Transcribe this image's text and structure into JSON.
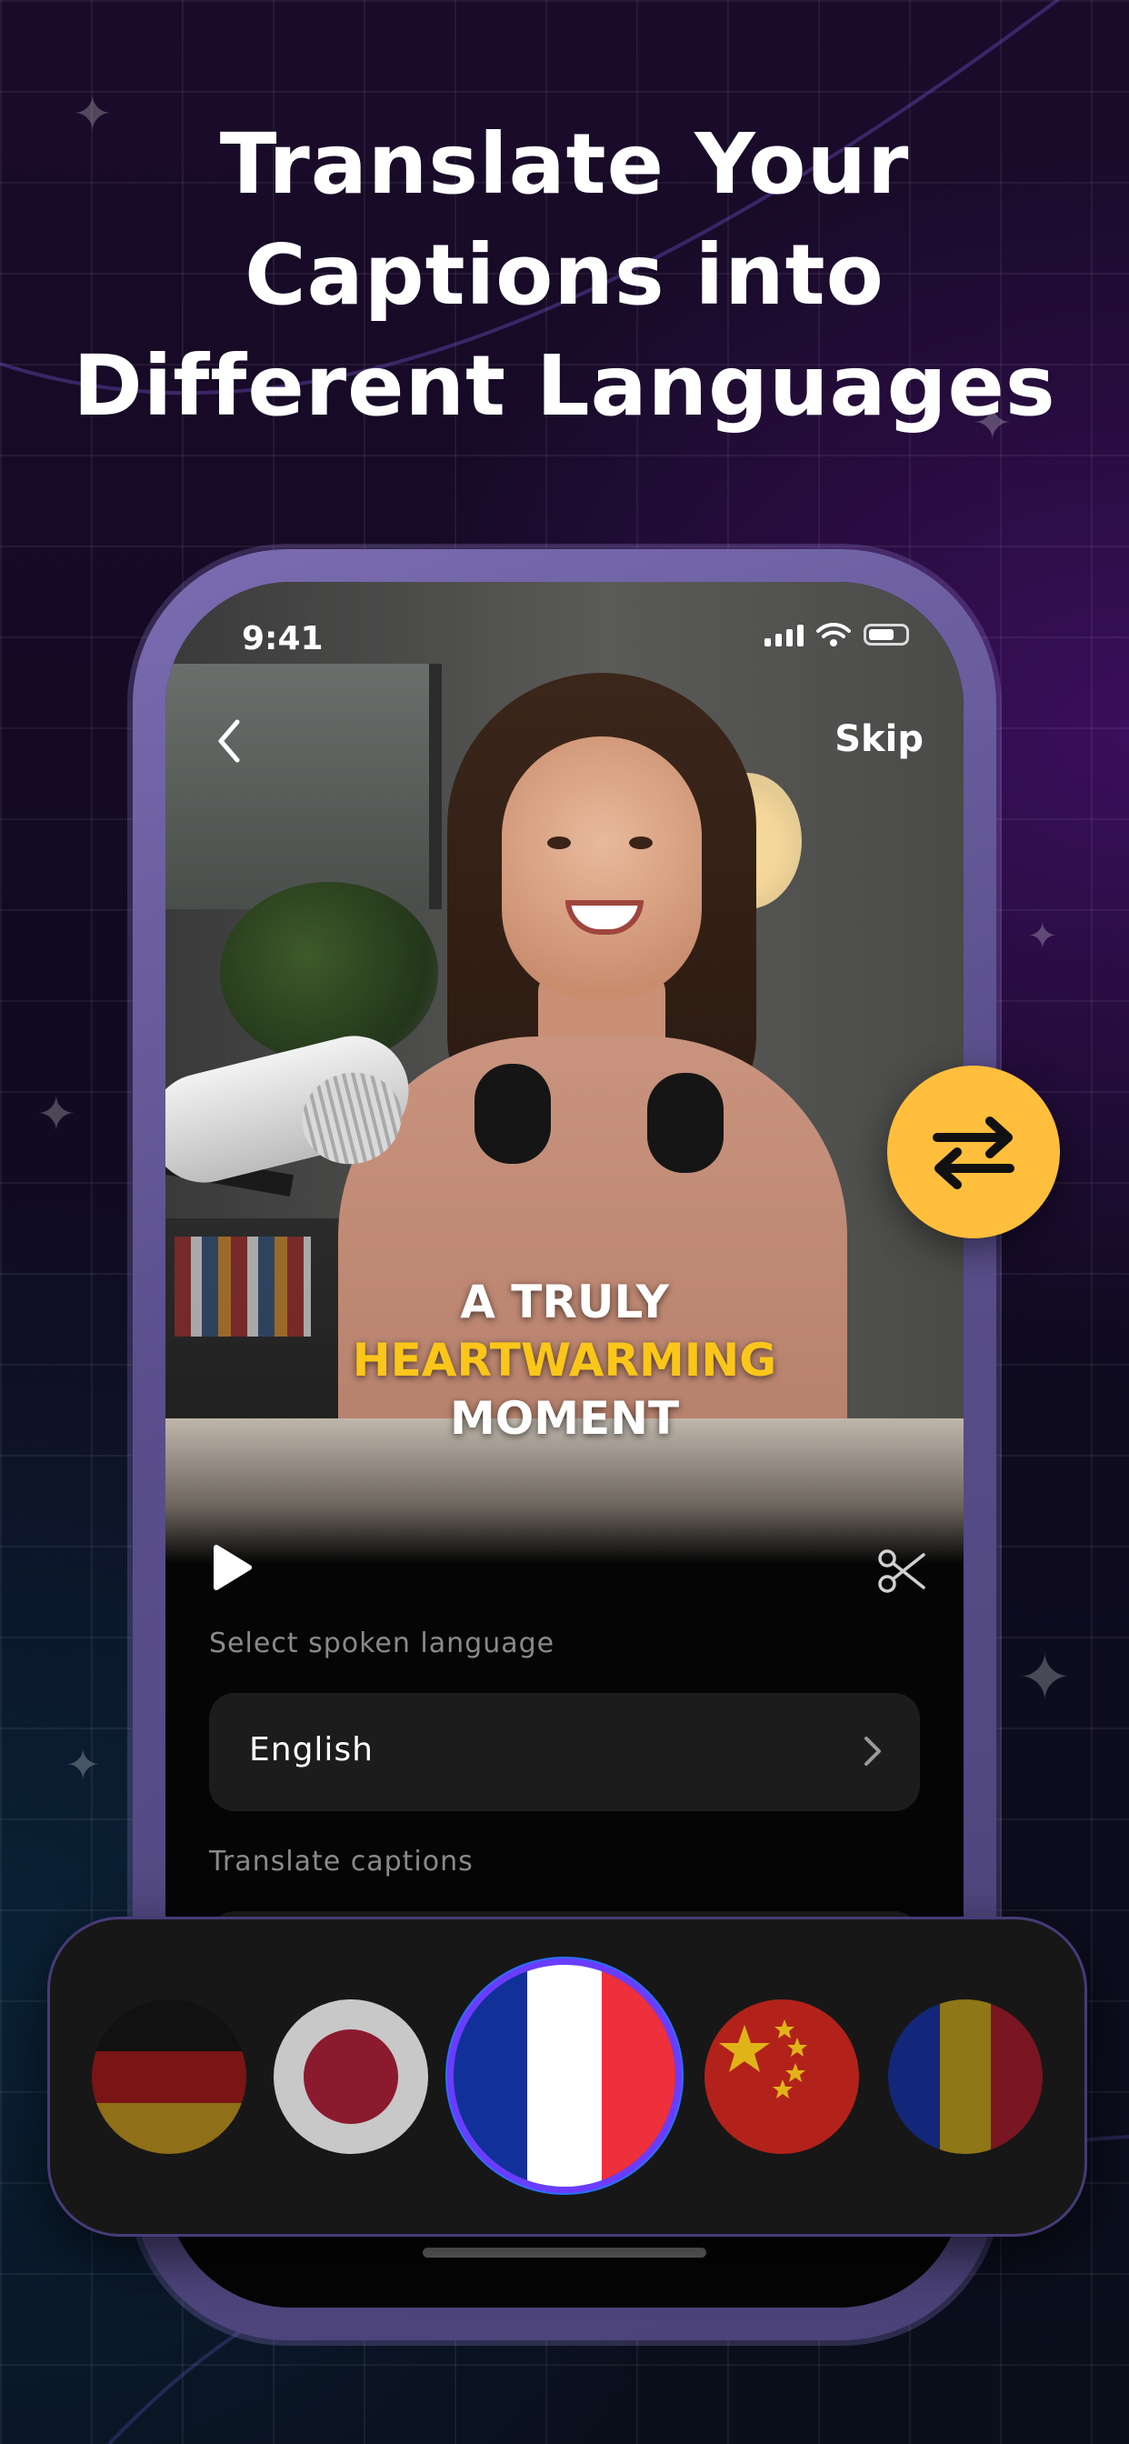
{
  "headline": {
    "line1": "Translate Your",
    "line2": "Captions into",
    "line3": "Different Languages"
  },
  "status_bar": {
    "time": "9:41"
  },
  "nav": {
    "skip_label": "Skip",
    "back_icon": "chevron-left-icon"
  },
  "caption": {
    "line1": "A TRULY",
    "line2": "HEARTWARMING",
    "line3": "MOMENT",
    "highlight_color": "#fbc61a"
  },
  "player": {
    "play_icon": "play-icon",
    "trim_icon": "scissors-icon"
  },
  "spoken_language": {
    "label": "Select spoken language",
    "value": "English"
  },
  "translate_captions": {
    "label": "Translate captions"
  },
  "swap_button": {
    "icon": "swap-arrows-icon",
    "color": "#ffbe3b"
  },
  "flags": {
    "items": [
      {
        "country": "Germany",
        "icon": "germany-flag-icon",
        "selected": false
      },
      {
        "country": "Japan",
        "icon": "japan-flag-icon",
        "selected": false
      },
      {
        "country": "France",
        "icon": "france-flag-icon",
        "selected": true
      },
      {
        "country": "China",
        "icon": "china-flag-icon",
        "selected": false
      },
      {
        "country": "Romania",
        "icon": "romania-flag-icon",
        "selected": false
      }
    ],
    "selected_ring_color": "#6a3cff"
  }
}
